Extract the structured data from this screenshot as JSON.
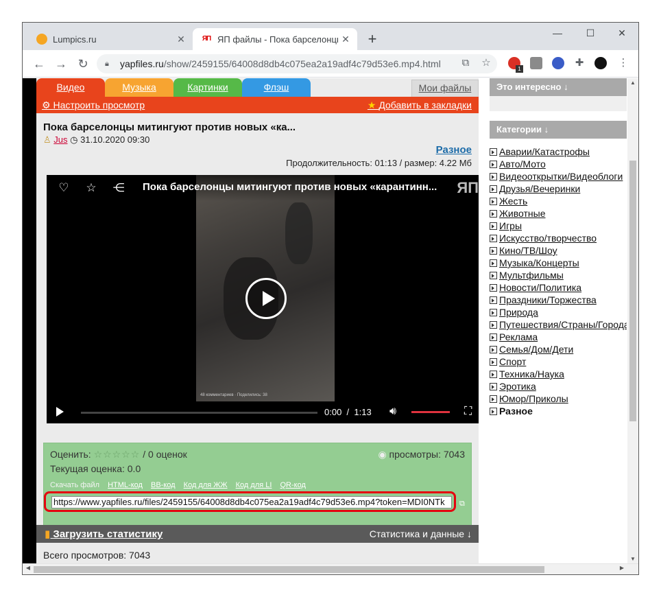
{
  "browser": {
    "tabs": [
      {
        "title": "Lumpics.ru",
        "favicon": "orange-circle-icon"
      },
      {
        "title": "ЯП файлы - Пока барселонцы м",
        "favicon": "yap-logo-icon",
        "favicon_text": "ЯП"
      }
    ],
    "new_tab": "+",
    "window_controls": {
      "minimize": "—",
      "maximize": "☐",
      "close": "✕"
    },
    "address": {
      "host": "yapfiles.ru",
      "path": "/show/2459155/64008d8db4c075ea2a19adf4c79d53e6.mp4.html"
    },
    "ext_badge": "1"
  },
  "site": {
    "nav_tabs": [
      {
        "label": "Видео",
        "color": "#e8441c"
      },
      {
        "label": "Музыка",
        "color": "#f7a431"
      },
      {
        "label": "Картинки",
        "color": "#56b948"
      },
      {
        "label": "Флэш",
        "color": "#3499e3"
      }
    ],
    "my_files": "Мои файлы",
    "settings_link": "Настроить просмотр",
    "bookmarks_link": "Добавить в закладки",
    "video_title": "Пока барселонцы митингуют против новых «ка...",
    "author": "Jus",
    "date": "31.10.2020 09:30",
    "category": "Разное",
    "duration_info": "Продолжительность: 01:13 / размер: 4.22 Мб",
    "player": {
      "title": "Пока барселонцы митингуют против новых «карантинн...",
      "logo": "ЯП",
      "time_current": "0:00",
      "time_sep": "/",
      "time_total": "1:13",
      "frame_caption": "48 комментариев · Поделились: 38"
    },
    "rating": {
      "label": "Оценить:",
      "stars": "☆☆☆☆☆",
      "count": "/ 0 оценок",
      "views": "просмотры: 7043",
      "current": "Текущая оценка: 0.0"
    },
    "download": {
      "label": "Скачать файл",
      "links": [
        "HTML-код",
        "BB-код",
        "Код для ЖЖ",
        "Код для LI",
        "QR-код"
      ]
    },
    "file_url": "https://www.yapfiles.ru/files/2459155/64008d8db4c075ea2a19adf4c79d53e6.mp4?token=MDI0NTk",
    "stats_link": "Загрузить статистику",
    "stats_data": "Статистика и данные ↓",
    "total_views": "Всего просмотров: 7043"
  },
  "sidebar": {
    "interesting": "Это интересно ↓",
    "categories_title": "Категории ↓",
    "categories": [
      "Аварии/Катастрофы",
      "Авто/Мото",
      "Видеооткрытки/Видеоблоги",
      "Друзья/Вечеринки",
      "Жесть",
      "Животные",
      "Игры",
      "Искусство/творчество",
      "Кино/ТВ/Шоу",
      "Музыка/Концерты",
      "Мультфильмы",
      "Новости/Политика",
      "Праздники/Торжества",
      "Природа",
      "Путешествия/Страны/Города",
      "Реклама",
      "Семья/Дом/Дети",
      "Спорт",
      "Техника/Наука",
      "Эротика",
      "Юмор/Приколы",
      "Разное"
    ],
    "current_category_index": 21
  },
  "colors": {
    "orange_bar": "#e8441c",
    "rate_box": "#94cd92",
    "url_highlight": "#e5000f",
    "stats_bar": "#5a5a5a"
  }
}
